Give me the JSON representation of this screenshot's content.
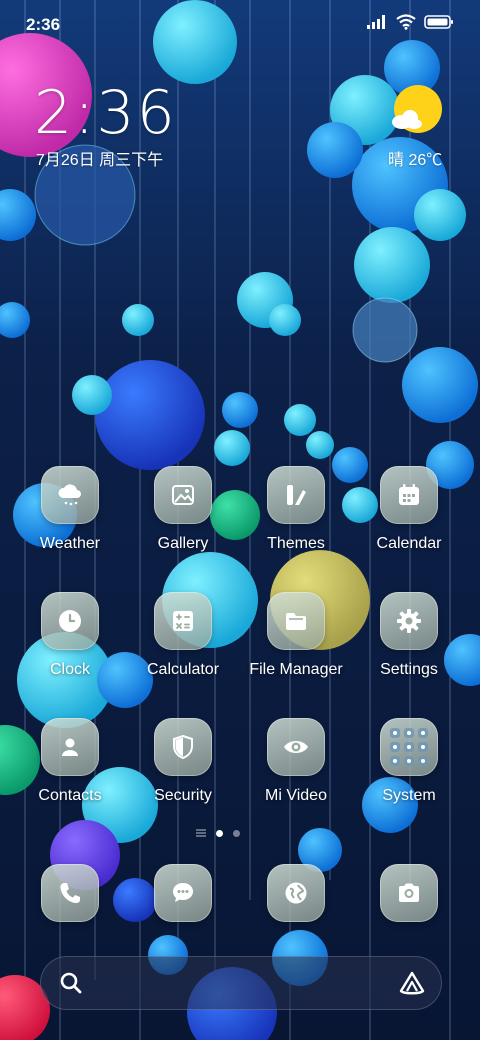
{
  "status": {
    "time": "2:36"
  },
  "lockclock": {
    "time": "2:36",
    "date": "7月26日 周三下午"
  },
  "weather": {
    "text": "晴 26℃",
    "icon": "sunny-cloud-icon"
  },
  "apps": [
    {
      "label": "Weather",
      "icon": "weather-icon"
    },
    {
      "label": "Gallery",
      "icon": "gallery-icon"
    },
    {
      "label": "Themes",
      "icon": "themes-icon"
    },
    {
      "label": "Calendar",
      "icon": "calendar-icon"
    },
    {
      "label": "Clock",
      "icon": "clock-icon"
    },
    {
      "label": "Calculator",
      "icon": "calculator-icon"
    },
    {
      "label": "File Manager",
      "icon": "folder-icon"
    },
    {
      "label": "Settings",
      "icon": "gear-icon"
    },
    {
      "label": "Contacts",
      "icon": "contacts-icon"
    },
    {
      "label": "Security",
      "icon": "shield-icon"
    },
    {
      "label": "Mi Video",
      "icon": "eye-icon"
    },
    {
      "label": "System",
      "icon": "folder-grid-icon"
    }
  ],
  "dock": [
    {
      "icon": "phone-icon"
    },
    {
      "icon": "messages-icon"
    },
    {
      "icon": "browser-icon"
    },
    {
      "icon": "camera-icon"
    }
  ],
  "pages": {
    "count": 2,
    "active": 0
  },
  "colors": {
    "icon_glyph": "#ffffff",
    "sun": "#ffd21a",
    "background": "#0a1a3a"
  }
}
